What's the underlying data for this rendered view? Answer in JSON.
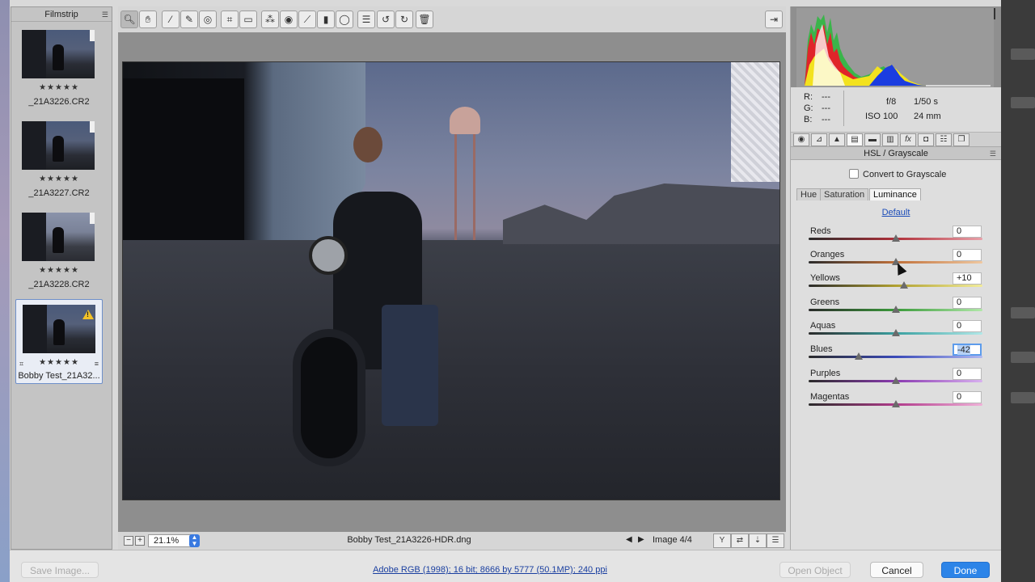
{
  "filmstrip": {
    "title": "Filmstrip",
    "items": [
      {
        "stars": "★★★★★",
        "name": "_21A3226.CR2",
        "selected": false
      },
      {
        "stars": "★★★★★",
        "name": "_21A3227.CR2",
        "selected": false
      },
      {
        "stars": "★★★★★",
        "name": "_21A3228.CR2",
        "selected": false
      },
      {
        "stars": "★★★★★",
        "name": "Bobby Test_21A32...",
        "selected": true
      }
    ]
  },
  "toolbar": {
    "tools": [
      "zoom-tool",
      "hand-tool",
      "white-balance-tool",
      "color-sampler-tool",
      "targeted-adjustment-tool",
      "crop-tool",
      "straighten-tool",
      "spot-removal-tool",
      "red-eye-tool",
      "adjustment-brush",
      "graduated-filter",
      "radial-filter",
      "preferences",
      "rotate-left",
      "rotate-right",
      "trash"
    ]
  },
  "preview": {
    "zoom": "21.1%",
    "filename": "Bobby Test_21A3226-HDR.dng",
    "image_count": "Image 4/4"
  },
  "histogram": {
    "colors": {
      "red": "#e0242a",
      "green": "#3ab54a",
      "blue": "#1b3de0",
      "yellow": "#f3e21e",
      "white": "#ffffff"
    }
  },
  "readout": {
    "r_label": "R:",
    "r_value": "---",
    "g_label": "G:",
    "g_value": "---",
    "b_label": "B:",
    "b_value": "---",
    "aperture": "f/8",
    "shutter": "1/50 s",
    "iso": "ISO 100",
    "focal": "24 mm"
  },
  "panel": {
    "title": "HSL / Grayscale",
    "convert_label": "Convert to Grayscale",
    "subtabs": [
      "Hue",
      "Saturation",
      "Luminance"
    ],
    "active_subtab": "Luminance",
    "default_link": "Default",
    "sliders": [
      {
        "label": "Reds",
        "value": "0",
        "num": 0,
        "focused": false
      },
      {
        "label": "Oranges",
        "value": "0",
        "num": 0,
        "focused": false
      },
      {
        "label": "Yellows",
        "value": "+10",
        "num": 10,
        "focused": false
      },
      {
        "label": "Greens",
        "value": "0",
        "num": 0,
        "focused": false
      },
      {
        "label": "Aquas",
        "value": "0",
        "num": 0,
        "focused": false
      },
      {
        "label": "Blues",
        "value": "-42",
        "num": -42,
        "focused": true
      },
      {
        "label": "Purples",
        "value": "0",
        "num": 0,
        "focused": false
      },
      {
        "label": "Magentas",
        "value": "0",
        "num": 0,
        "focused": false
      }
    ]
  },
  "bottom": {
    "save_label": "Save Image...",
    "info": "Adobe RGB (1998); 16 bit; 8666 by 5777 (50.1MP); 240 ppi",
    "open_label": "Open Object",
    "cancel_label": "Cancel",
    "done_label": "Done"
  }
}
